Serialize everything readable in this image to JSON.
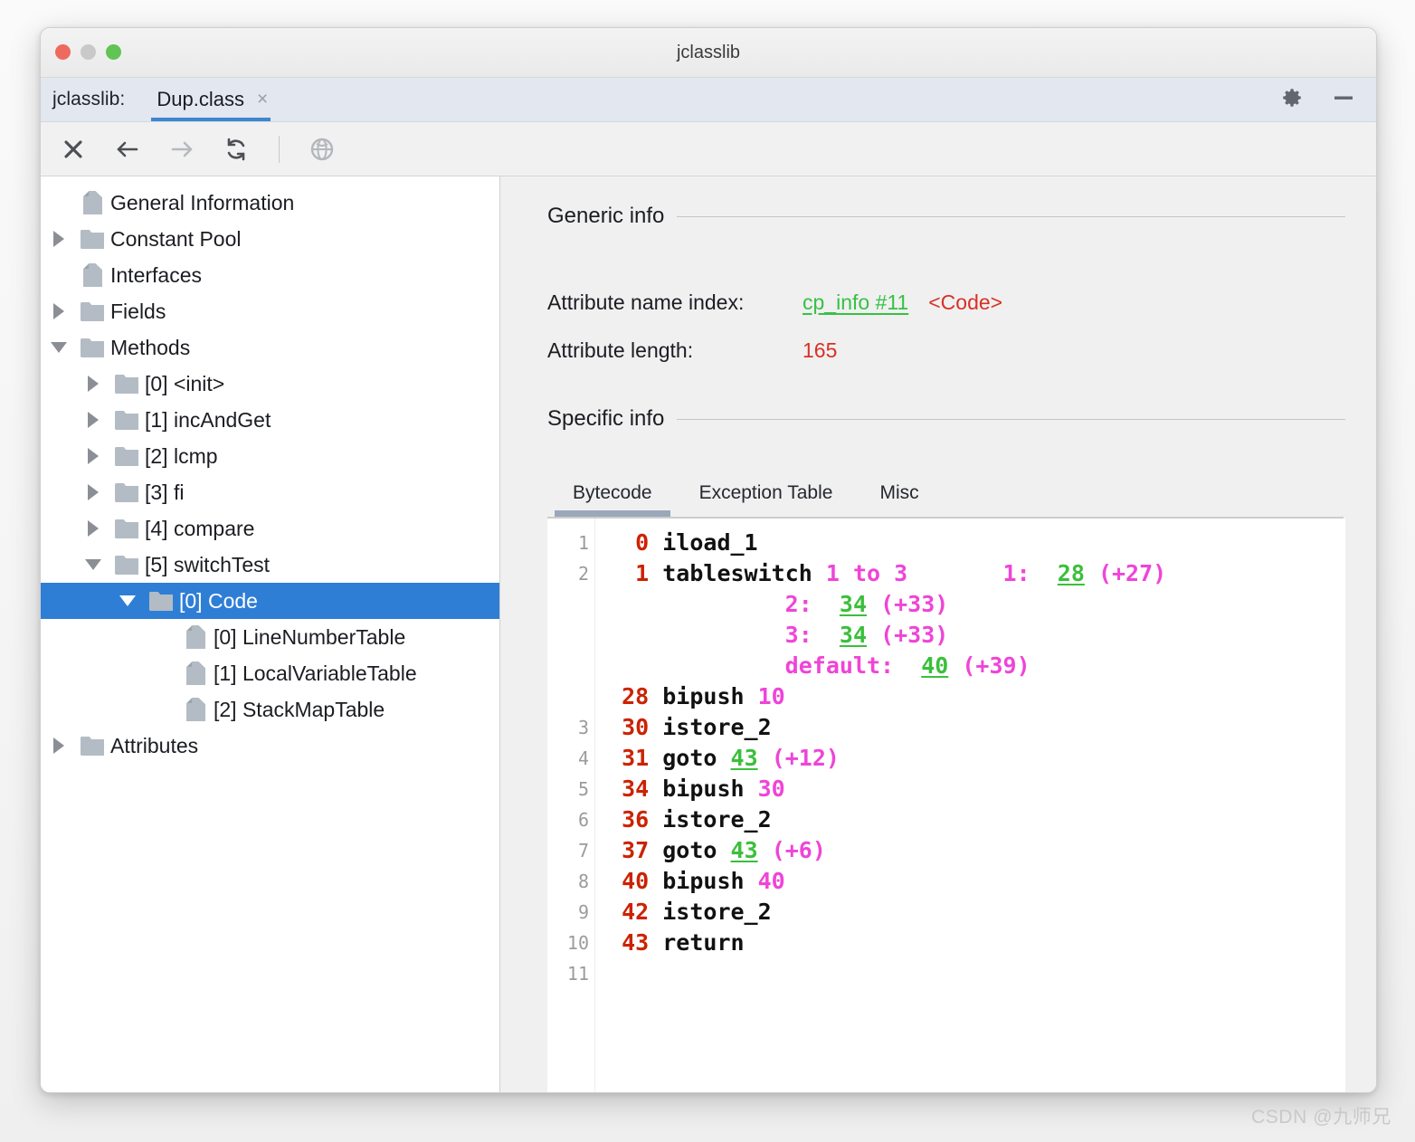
{
  "window": {
    "title": "jclasslib",
    "traffic_lights": [
      "close",
      "minimize",
      "zoom"
    ]
  },
  "tabstrip": {
    "app_label": "jclasslib:",
    "document_tab": "Dup.class",
    "close_tab_glyph": "×",
    "gear_icon": "gear-icon",
    "minimize_icon": "minimize-icon"
  },
  "toolbar": {
    "buttons": [
      {
        "name": "close-icon",
        "glyph": "✕",
        "enabled": true
      },
      {
        "name": "back-arrow-icon",
        "glyph": "←",
        "enabled": true
      },
      {
        "name": "forward-arrow-icon",
        "glyph": "→",
        "enabled": false
      },
      {
        "name": "reload-icon",
        "glyph": "↻",
        "enabled": true
      },
      {
        "name": "browse-globe-icon",
        "glyph": "ἱ0",
        "enabled": false
      }
    ]
  },
  "tree": {
    "items": [
      {
        "label": "General Information",
        "icon": "document-icon",
        "indent": 1,
        "twisty": "none",
        "selected": false
      },
      {
        "label": "Constant Pool",
        "icon": "folder-icon",
        "indent": 1,
        "twisty": "collapsed",
        "selected": false
      },
      {
        "label": "Interfaces",
        "icon": "document-icon",
        "indent": 1,
        "twisty": "none",
        "selected": false
      },
      {
        "label": "Fields",
        "icon": "folder-icon",
        "indent": 1,
        "twisty": "collapsed",
        "selected": false
      },
      {
        "label": "Methods",
        "icon": "folder-icon",
        "indent": 1,
        "twisty": "expanded",
        "selected": false
      },
      {
        "label": "[0] <init>",
        "icon": "folder-icon",
        "indent": 2,
        "twisty": "collapsed",
        "selected": false
      },
      {
        "label": "[1] incAndGet",
        "icon": "folder-icon",
        "indent": 2,
        "twisty": "collapsed",
        "selected": false
      },
      {
        "label": "[2] lcmp",
        "icon": "folder-icon",
        "indent": 2,
        "twisty": "collapsed",
        "selected": false
      },
      {
        "label": "[3] fi",
        "icon": "folder-icon",
        "indent": 2,
        "twisty": "collapsed",
        "selected": false
      },
      {
        "label": "[4] compare",
        "icon": "folder-icon",
        "indent": 2,
        "twisty": "collapsed",
        "selected": false
      },
      {
        "label": "[5] switchTest",
        "icon": "folder-icon",
        "indent": 2,
        "twisty": "expanded",
        "selected": false
      },
      {
        "label": "[0] Code",
        "icon": "folder-icon",
        "indent": 3,
        "twisty": "expanded",
        "selected": true
      },
      {
        "label": "[0] LineNumberTable",
        "icon": "document-icon",
        "indent": 4,
        "twisty": "none",
        "selected": false
      },
      {
        "label": "[1] LocalVariableTable",
        "icon": "document-icon",
        "indent": 4,
        "twisty": "none",
        "selected": false
      },
      {
        "label": "[2] StackMapTable",
        "icon": "document-icon",
        "indent": 4,
        "twisty": "none",
        "selected": false
      },
      {
        "label": "Attributes",
        "icon": "folder-icon",
        "indent": 1,
        "twisty": "collapsed",
        "selected": false
      }
    ]
  },
  "detail": {
    "generic_info_title": "Generic info",
    "attribute_name_index_label": "Attribute name index:",
    "attribute_name_index_link": "cp_info #11",
    "attribute_name_index_value": "<Code>",
    "attribute_length_label": "Attribute length:",
    "attribute_length_value": "165",
    "specific_info_title": "Specific info",
    "tabs": [
      {
        "label": "Bytecode",
        "selected": true
      },
      {
        "label": "Exception Table",
        "selected": false
      },
      {
        "label": "Misc",
        "selected": false
      }
    ]
  },
  "bytecode": {
    "gutter_numbers": [
      "1",
      "2",
      "",
      "",
      "",
      "",
      "3",
      "4",
      "5",
      "6",
      "7",
      "8",
      "9",
      "10",
      "11"
    ],
    "lines": [
      [
        {
          "t": "  ",
          "c": "mn"
        },
        {
          "t": "0",
          "c": "off"
        },
        {
          "t": " ",
          "c": "mn"
        },
        {
          "t": "iload_1",
          "c": "mn"
        }
      ],
      [
        {
          "t": "  ",
          "c": "mn"
        },
        {
          "t": "1",
          "c": "off"
        },
        {
          "t": " ",
          "c": "mn"
        },
        {
          "t": "tableswitch",
          "c": "mn"
        },
        {
          "t": " ",
          "c": "mn"
        },
        {
          "t": "1 to 3",
          "c": "op"
        },
        {
          "t": "       ",
          "c": "mn"
        },
        {
          "t": "1:",
          "c": "op"
        },
        {
          "t": "  ",
          "c": "mn"
        },
        {
          "t": "28",
          "c": "tgt"
        },
        {
          "t": " ",
          "c": "mn"
        },
        {
          "t": "(+27)",
          "c": "op"
        }
      ],
      [
        {
          "t": "             ",
          "c": "mn"
        },
        {
          "t": "2:",
          "c": "op"
        },
        {
          "t": "  ",
          "c": "mn"
        },
        {
          "t": "34",
          "c": "tgt"
        },
        {
          "t": " ",
          "c": "mn"
        },
        {
          "t": "(+33)",
          "c": "op"
        }
      ],
      [
        {
          "t": "             ",
          "c": "mn"
        },
        {
          "t": "3:",
          "c": "op"
        },
        {
          "t": "  ",
          "c": "mn"
        },
        {
          "t": "34",
          "c": "tgt"
        },
        {
          "t": " ",
          "c": "mn"
        },
        {
          "t": "(+33)",
          "c": "op"
        }
      ],
      [
        {
          "t": "             ",
          "c": "mn"
        },
        {
          "t": "default:",
          "c": "op"
        },
        {
          "t": "  ",
          "c": "mn"
        },
        {
          "t": "40",
          "c": "tgt"
        },
        {
          "t": " ",
          "c": "mn"
        },
        {
          "t": "(+39)",
          "c": "op"
        }
      ],
      [
        {
          "t": " ",
          "c": "mn"
        },
        {
          "t": "28",
          "c": "off"
        },
        {
          "t": " ",
          "c": "mn"
        },
        {
          "t": "bipush",
          "c": "mn"
        },
        {
          "t": " ",
          "c": "mn"
        },
        {
          "t": "10",
          "c": "op"
        }
      ],
      [
        {
          "t": " ",
          "c": "mn"
        },
        {
          "t": "30",
          "c": "off"
        },
        {
          "t": " ",
          "c": "mn"
        },
        {
          "t": "istore_2",
          "c": "mn"
        }
      ],
      [
        {
          "t": " ",
          "c": "mn"
        },
        {
          "t": "31",
          "c": "off"
        },
        {
          "t": " ",
          "c": "mn"
        },
        {
          "t": "goto",
          "c": "mn"
        },
        {
          "t": " ",
          "c": "mn"
        },
        {
          "t": "43",
          "c": "tgt"
        },
        {
          "t": " ",
          "c": "mn"
        },
        {
          "t": "(+12)",
          "c": "op"
        }
      ],
      [
        {
          "t": " ",
          "c": "mn"
        },
        {
          "t": "34",
          "c": "off"
        },
        {
          "t": " ",
          "c": "mn"
        },
        {
          "t": "bipush",
          "c": "mn"
        },
        {
          "t": " ",
          "c": "mn"
        },
        {
          "t": "30",
          "c": "op"
        }
      ],
      [
        {
          "t": " ",
          "c": "mn"
        },
        {
          "t": "36",
          "c": "off"
        },
        {
          "t": " ",
          "c": "mn"
        },
        {
          "t": "istore_2",
          "c": "mn"
        }
      ],
      [
        {
          "t": " ",
          "c": "mn"
        },
        {
          "t": "37",
          "c": "off"
        },
        {
          "t": " ",
          "c": "mn"
        },
        {
          "t": "goto",
          "c": "mn"
        },
        {
          "t": " ",
          "c": "mn"
        },
        {
          "t": "43",
          "c": "tgt"
        },
        {
          "t": " ",
          "c": "mn"
        },
        {
          "t": "(+6)",
          "c": "op"
        }
      ],
      [
        {
          "t": " ",
          "c": "mn"
        },
        {
          "t": "40",
          "c": "off"
        },
        {
          "t": " ",
          "c": "mn"
        },
        {
          "t": "bipush",
          "c": "mn"
        },
        {
          "t": " ",
          "c": "mn"
        },
        {
          "t": "40",
          "c": "op"
        }
      ],
      [
        {
          "t": " ",
          "c": "mn"
        },
        {
          "t": "42",
          "c": "off"
        },
        {
          "t": " ",
          "c": "mn"
        },
        {
          "t": "istore_2",
          "c": "mn"
        }
      ],
      [
        {
          "t": " ",
          "c": "mn"
        },
        {
          "t": "43",
          "c": "off"
        },
        {
          "t": " ",
          "c": "mn"
        },
        {
          "t": "return",
          "c": "mn"
        }
      ],
      []
    ]
  },
  "watermark": "CSDN @九师兄",
  "colors": {
    "accent_tab": "#3d87d0",
    "selection": "#2f7ed6",
    "offset": "#cc2200",
    "operand": "#ef44d8",
    "branch_target": "#3bbf3b",
    "link_green": "#36c145",
    "value_red": "#d93025",
    "subtab_indicator": "#9aa8ba"
  }
}
